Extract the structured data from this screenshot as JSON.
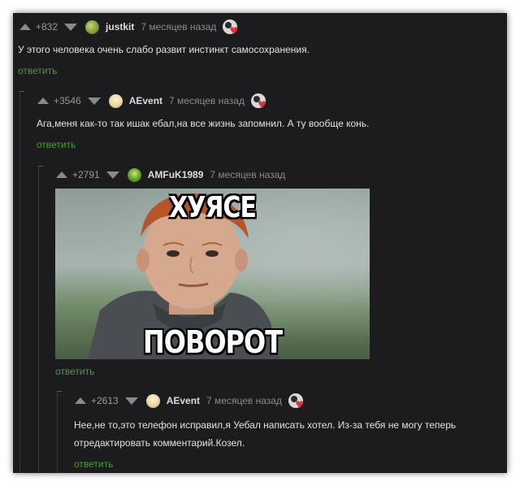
{
  "comments": [
    {
      "rating": "+832",
      "username": "justkit",
      "time": "7 месяцев назад",
      "text": "У этого человека очень слабо развит инстинкт самосохранения.",
      "reply": "ответить",
      "avatar_color": "#7a9a3a"
    },
    {
      "rating": "+3546",
      "username": "AEvent",
      "time": "7 месяцев назад",
      "text": "Ага,меня как-то так ишак ебал,на все жизнь запомнил. А ту вообще конь.",
      "reply": "ответить",
      "avatar_color": "#e8d6a8"
    },
    {
      "rating": "+2791",
      "username": "AMFuK1989",
      "time": "7 месяцев назад",
      "meme_top": "ХУЯСЕ",
      "meme_bottom": "ПОВОРОТ",
      "reply": "ответить",
      "avatar_color": "#5aa02c"
    },
    {
      "rating": "+2613",
      "username": "AEvent",
      "time": "7 месяцев назад",
      "text_line1": "Нее,не то,это телефон исправил,я Уебал написать хотел. Из-за тебя не могу теперь",
      "text_line2": "отредактировать комментарий.Козел.",
      "reply": "ответить",
      "avatar_color": "#e8d6a8"
    }
  ],
  "colors": {
    "background": "#1c1c1e",
    "text": "#e2e2e2",
    "meta": "#8a8a8a",
    "reply": "#4e9a3a"
  }
}
